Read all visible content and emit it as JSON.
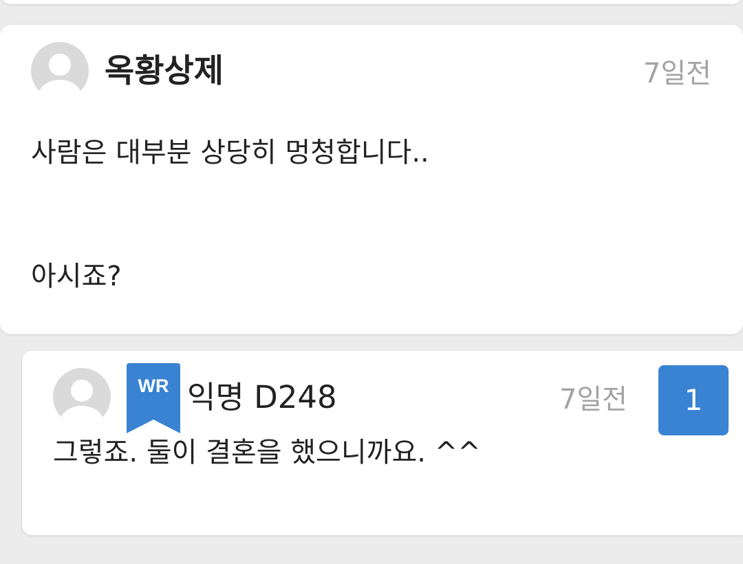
{
  "comment": {
    "author": "옥황상제",
    "time": "7일전",
    "lines": [
      "사람은 대부분 상당히 멍청합니다..",
      "아시죠?"
    ]
  },
  "reply": {
    "badge": "WR",
    "author": "익명 D248",
    "time": "7일전",
    "like_count": "1",
    "text": "그렇죠. 둘이 결혼을 했으니까요. ^^"
  },
  "colors": {
    "accent": "#3a83d2",
    "muted_text": "#a3a3a3",
    "background": "#ececec"
  },
  "icons": {
    "avatar": "default-user-avatar-icon",
    "badge": "bookmark-ribbon-icon"
  }
}
